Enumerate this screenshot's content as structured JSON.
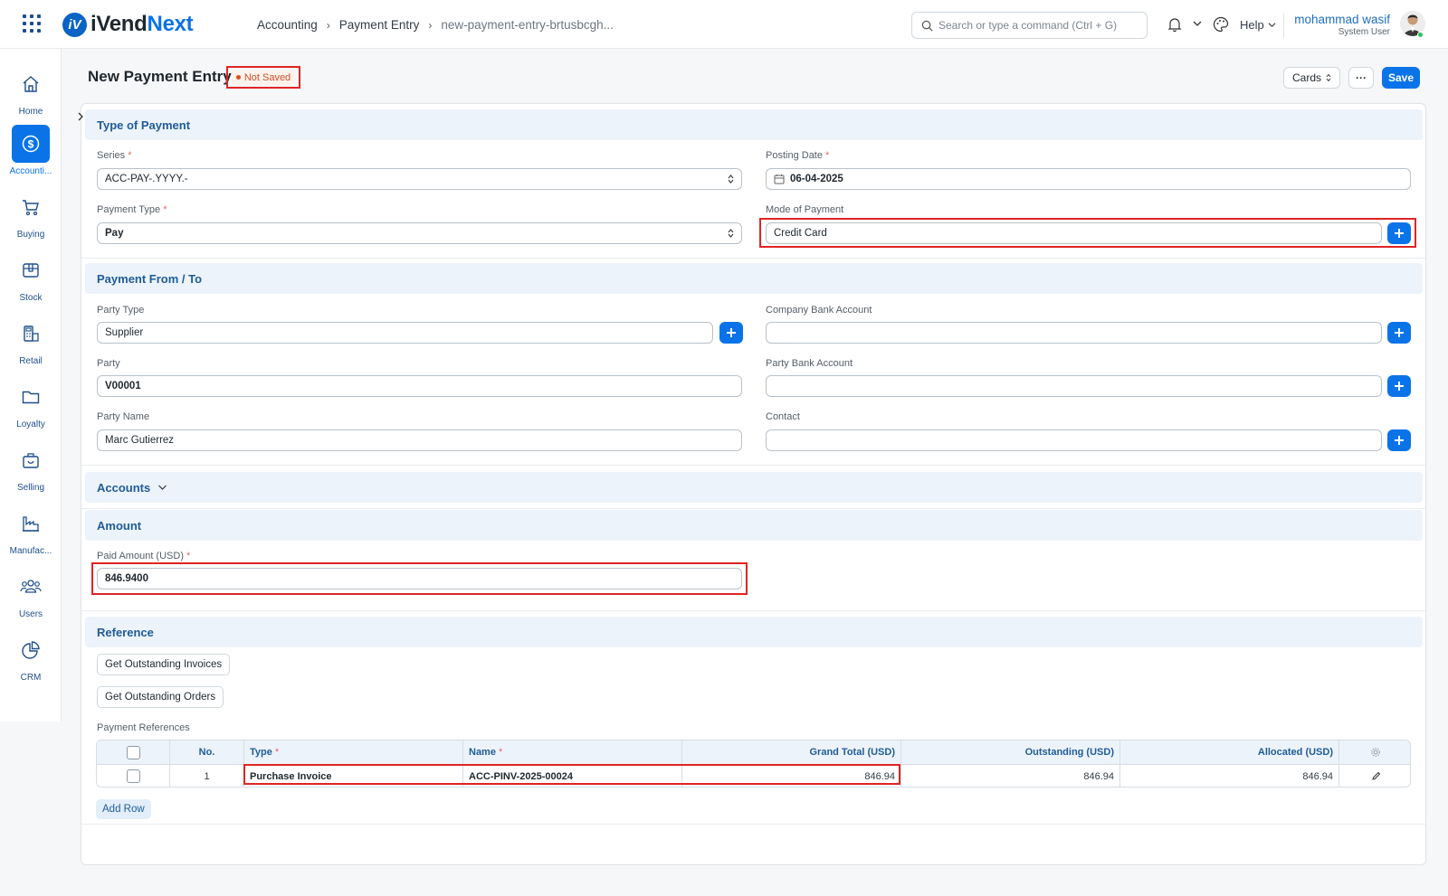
{
  "app": {
    "logo_first": "iVend",
    "logo_second": "Next",
    "logo_mark": "iV"
  },
  "breadcrumb": [
    "Accounting",
    "Payment Entry",
    "new-payment-entry-brtusbcgh..."
  ],
  "search": {
    "placeholder": "Search or type a command (Ctrl + G)"
  },
  "help_label": "Help",
  "user": {
    "name": "mohammad wasif",
    "role": "System User"
  },
  "sidebar": [
    {
      "label": "Home",
      "icon": "home-icon"
    },
    {
      "label": "Accounti...",
      "icon": "dollar-icon",
      "active": true
    },
    {
      "label": "Buying",
      "icon": "cart-icon"
    },
    {
      "label": "Stock",
      "icon": "box-icon"
    },
    {
      "label": "Retail",
      "icon": "pos-icon"
    },
    {
      "label": "Loyalty",
      "icon": "folder-icon"
    },
    {
      "label": "Selling",
      "icon": "bag-icon"
    },
    {
      "label": "Manufac...",
      "icon": "factory-icon"
    },
    {
      "label": "Users",
      "icon": "users-icon"
    },
    {
      "label": "CRM",
      "icon": "pie-icon"
    }
  ],
  "page": {
    "title": "New Payment Entry",
    "status": "Not Saved"
  },
  "actions": {
    "cards": "Cards",
    "more": "···",
    "save": "Save"
  },
  "sections": {
    "type_of_payment": "Type of Payment",
    "payment_from_to": "Payment From / To",
    "accounts": "Accounts",
    "amount": "Amount",
    "reference": "Reference"
  },
  "fields": {
    "series": {
      "label": "Series",
      "value": "ACC-PAY-.YYYY.-"
    },
    "posting_date": {
      "label": "Posting Date",
      "value": "06-04-2025"
    },
    "payment_type": {
      "label": "Payment Type",
      "value": "Pay"
    },
    "mode_of_payment": {
      "label": "Mode of Payment",
      "value": "Credit Card"
    },
    "party_type": {
      "label": "Party Type",
      "value": "Supplier"
    },
    "company_bank_account": {
      "label": "Company Bank Account",
      "value": ""
    },
    "party": {
      "label": "Party",
      "value": "V00001"
    },
    "party_bank_account": {
      "label": "Party Bank Account",
      "value": ""
    },
    "party_name": {
      "label": "Party Name",
      "value": "Marc Gutierrez"
    },
    "contact": {
      "label": "Contact",
      "value": ""
    },
    "paid_amount": {
      "label": "Paid Amount (USD)",
      "value": "846.9400"
    }
  },
  "reference": {
    "get_invoices": "Get Outstanding Invoices",
    "get_orders": "Get Outstanding Orders",
    "table_label": "Payment References",
    "columns": {
      "no": "No.",
      "type": "Type",
      "name": "Name",
      "grand_total": "Grand Total (USD)",
      "outstanding": "Outstanding (USD)",
      "allocated": "Allocated (USD)"
    },
    "rows": [
      {
        "no": "1",
        "type": "Purchase Invoice",
        "name": "ACC-PINV-2025-00024",
        "grand_total": "846.94",
        "outstanding": "846.94",
        "allocated": "846.94"
      }
    ],
    "add_row": "Add Row"
  },
  "colors": {
    "accent": "#0b73e8",
    "highlight": "#e02424",
    "section_bg": "#edf3fa"
  }
}
